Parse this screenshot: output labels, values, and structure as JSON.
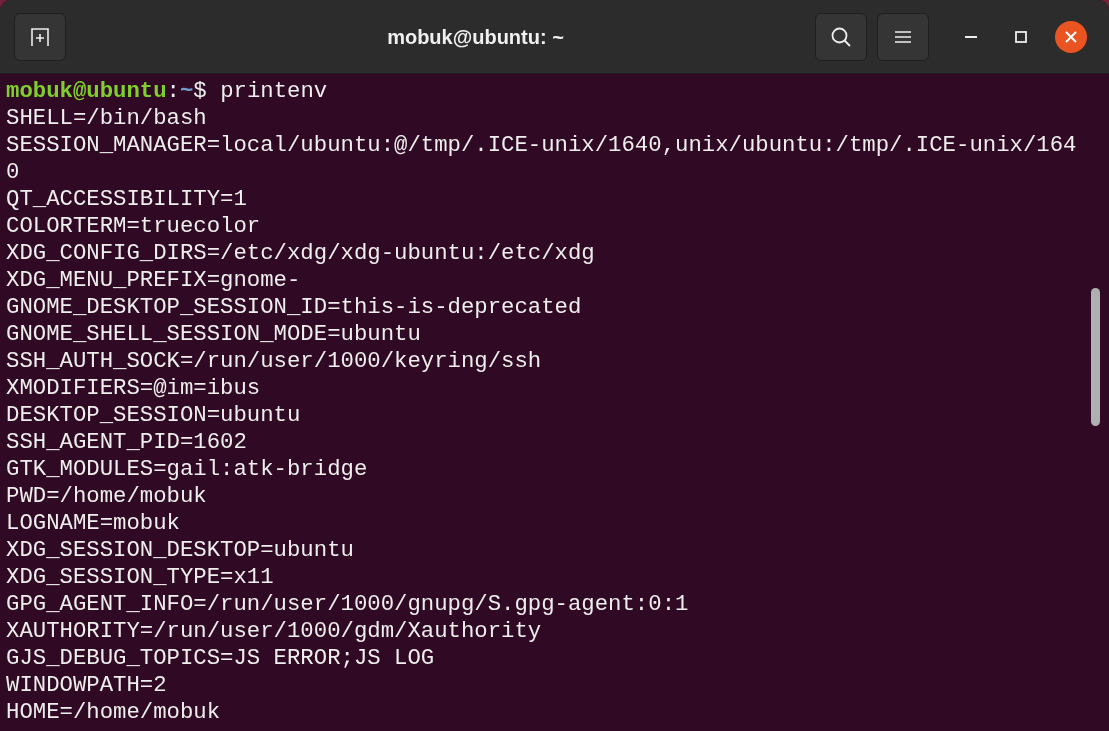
{
  "window": {
    "title": "mobuk@ubuntu: ~"
  },
  "prompt": {
    "user_host": "mobuk@ubuntu",
    "separator": ":",
    "path": "~",
    "symbol": "$",
    "command": "printenv"
  },
  "output_lines": [
    "SHELL=/bin/bash",
    "SESSION_MANAGER=local/ubuntu:@/tmp/.ICE-unix/1640,unix/ubuntu:/tmp/.ICE-unix/164",
    "0",
    "QT_ACCESSIBILITY=1",
    "COLORTERM=truecolor",
    "XDG_CONFIG_DIRS=/etc/xdg/xdg-ubuntu:/etc/xdg",
    "XDG_MENU_PREFIX=gnome-",
    "GNOME_DESKTOP_SESSION_ID=this-is-deprecated",
    "GNOME_SHELL_SESSION_MODE=ubuntu",
    "SSH_AUTH_SOCK=/run/user/1000/keyring/ssh",
    "XMODIFIERS=@im=ibus",
    "DESKTOP_SESSION=ubuntu",
    "SSH_AGENT_PID=1602",
    "GTK_MODULES=gail:atk-bridge",
    "PWD=/home/mobuk",
    "LOGNAME=mobuk",
    "XDG_SESSION_DESKTOP=ubuntu",
    "XDG_SESSION_TYPE=x11",
    "GPG_AGENT_INFO=/run/user/1000/gnupg/S.gpg-agent:0:1",
    "XAUTHORITY=/run/user/1000/gdm/Xauthority",
    "GJS_DEBUG_TOPICS=JS ERROR;JS LOG",
    "WINDOWPATH=2",
    "HOME=/home/mobuk"
  ]
}
